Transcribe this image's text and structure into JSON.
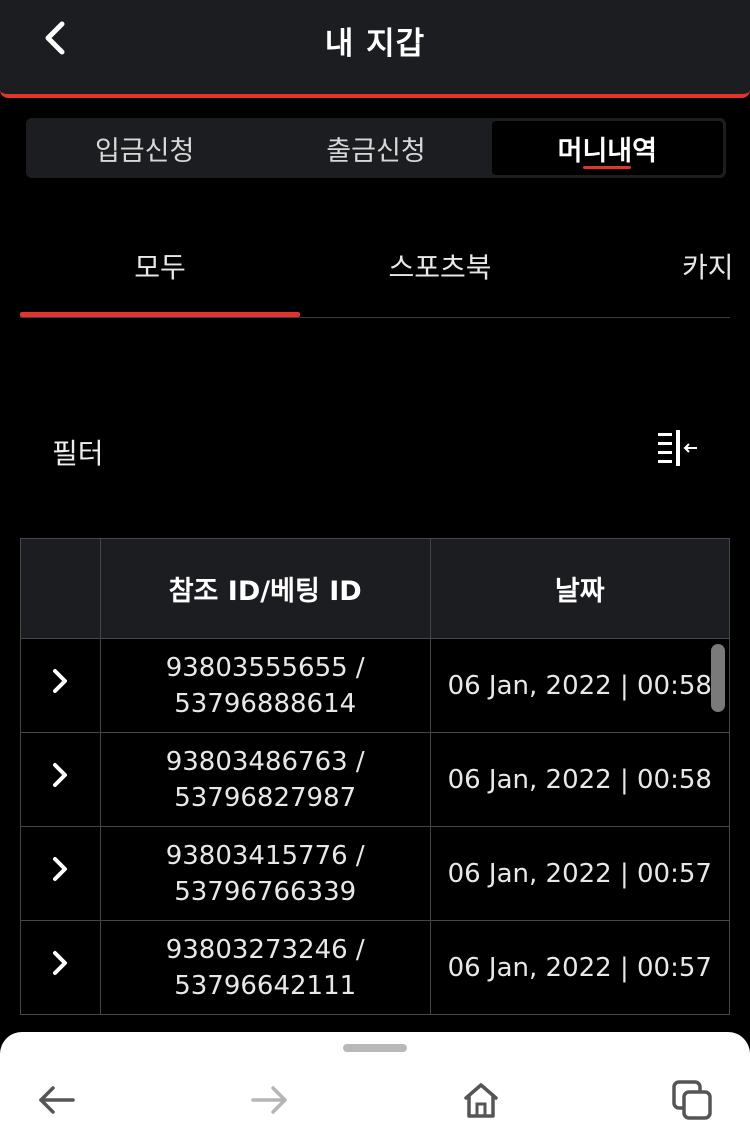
{
  "header": {
    "title": "내 지갑"
  },
  "segments": [
    {
      "label": "입금신청",
      "active": false
    },
    {
      "label": "출금신청",
      "active": false
    },
    {
      "label": "머니내역",
      "active": true
    }
  ],
  "categories": [
    {
      "label": "모두",
      "active": true
    },
    {
      "label": "스포츠북",
      "active": false
    },
    {
      "label": "카지",
      "active": false
    }
  ],
  "filter": {
    "label": "필터"
  },
  "table": {
    "headers": [
      "",
      "참조 ID/베팅 ID",
      "날짜"
    ],
    "rows": [
      {
        "ref": "93803555655 /",
        "bet": "53796888614",
        "date": "06 Jan, 2022 | 00:58"
      },
      {
        "ref": "93803486763 /",
        "bet": "53796827987",
        "date": "06 Jan, 2022 | 00:58"
      },
      {
        "ref": "93803415776 /",
        "bet": "53796766339",
        "date": "06 Jan, 2022 | 00:57"
      },
      {
        "ref": "93803273246 /",
        "bet": "53796642111",
        "date": "06 Jan, 2022 | 00:57"
      }
    ]
  },
  "colors": {
    "accent": "#e3342b",
    "surface": "#1c1d21",
    "background": "#000000"
  },
  "icons": {
    "back": "chevron-left-icon",
    "filter": "filter-collapse-icon",
    "row_expand": "chevron-right-icon",
    "browser": [
      "arrow-left-icon",
      "arrow-right-icon",
      "home-icon",
      "tabs-icon"
    ]
  }
}
